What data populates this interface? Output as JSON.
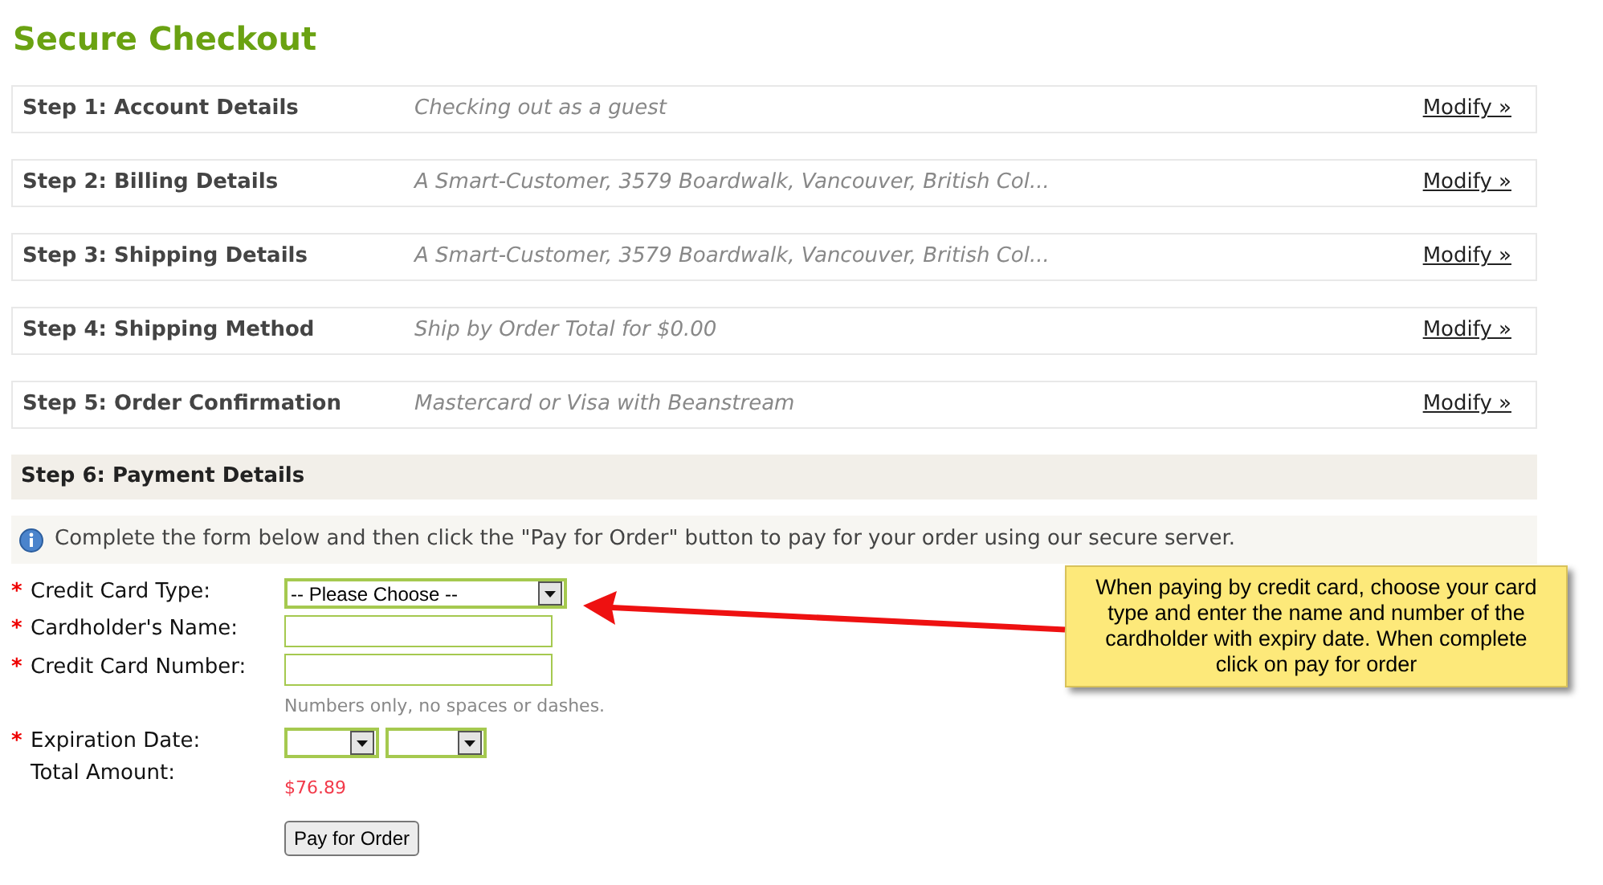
{
  "title": "Secure Checkout",
  "steps": [
    {
      "label": "Step 1: Account Details",
      "summary": "Checking out as a guest",
      "action": "Modify »"
    },
    {
      "label": "Step 2: Billing Details",
      "summary": "A Smart-Customer, 3579 Boardwalk, Vancouver, British Col...",
      "action": "Modify »"
    },
    {
      "label": "Step 3: Shipping Details",
      "summary": "A Smart-Customer, 3579 Boardwalk, Vancouver, British Col...",
      "action": "Modify »"
    },
    {
      "label": "Step 4: Shipping Method",
      "summary": "Ship by Order Total for $0.00",
      "action": "Modify »"
    },
    {
      "label": "Step 5: Order Confirmation",
      "summary": "Mastercard or Visa with Beanstream",
      "action": "Modify »"
    }
  ],
  "payment": {
    "heading": "Step 6: Payment Details",
    "info": "Complete the form below and then click the \"Pay for Order\" button to pay for your order using our secure server.",
    "required_mark": "*",
    "fields": [
      {
        "kind": "select",
        "label": "Credit Card Type:",
        "required": true,
        "value": "-- Please Choose --"
      },
      {
        "kind": "text",
        "label": "Cardholder's Name:",
        "required": true
      },
      {
        "kind": "text",
        "label": "Credit Card Number:",
        "required": true,
        "hint": "Numbers only, no spaces or dashes."
      },
      {
        "kind": "date",
        "label": "Expiration Date:",
        "required": true
      },
      {
        "kind": "amount",
        "label": "Total Amount:",
        "required": false,
        "value": "$76.89"
      }
    ],
    "submit": "Pay for Order"
  },
  "callout": {
    "text": "When paying by credit card, choose your card type and enter the name and number of the cardholder with expiry date. When complete click on pay for order"
  }
}
